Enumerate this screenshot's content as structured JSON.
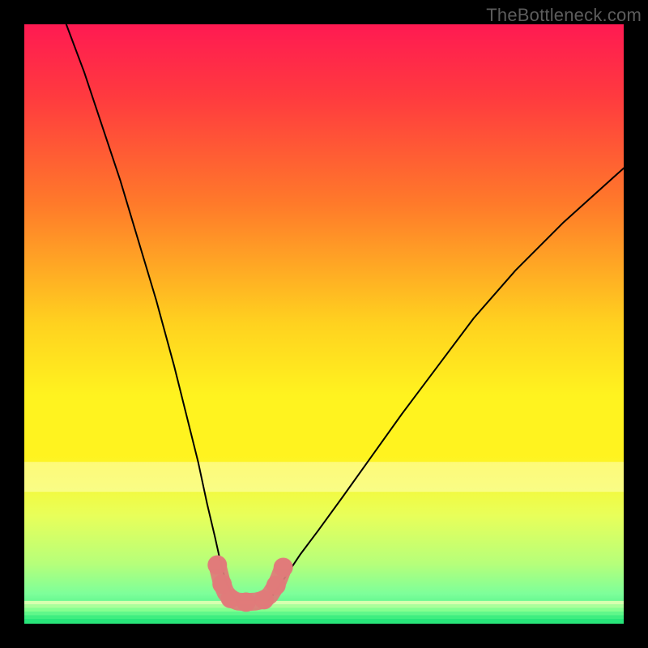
{
  "watermark": "TheBottleneck.com",
  "chart_data": {
    "type": "line",
    "title": "",
    "xlabel": "",
    "ylabel": "",
    "xlim": [
      0,
      100
    ],
    "ylim": [
      0,
      100
    ],
    "grid": false,
    "legend": null,
    "background_gradient": {
      "stops": [
        {
          "pos": 0.0,
          "color": "#ff1a52"
        },
        {
          "pos": 0.12,
          "color": "#ff3a3f"
        },
        {
          "pos": 0.3,
          "color": "#ff7a2a"
        },
        {
          "pos": 0.5,
          "color": "#ffd21f"
        },
        {
          "pos": 0.62,
          "color": "#fff31f"
        },
        {
          "pos": 0.72,
          "color": "#fff31f"
        },
        {
          "pos": 0.82,
          "color": "#e8ff5a"
        },
        {
          "pos": 0.9,
          "color": "#b6ff7a"
        },
        {
          "pos": 0.95,
          "color": "#7dff9a"
        },
        {
          "pos": 1.0,
          "color": "#28e57a"
        }
      ]
    },
    "series": [
      {
        "name": "left-curve",
        "color": "#000000",
        "width": 2,
        "x": [
          7,
          10,
          13,
          16,
          19,
          22,
          25,
          27,
          29,
          30.5,
          31.8,
          32.8,
          33.5,
          34.2,
          34.8,
          35.4
        ],
        "y": [
          100,
          92,
          83,
          74,
          64,
          54,
          43,
          35,
          27,
          20,
          14.5,
          10,
          7.5,
          5.8,
          4.6,
          4.0
        ]
      },
      {
        "name": "right-curve",
        "color": "#000000",
        "width": 2,
        "x": [
          40.8,
          41.5,
          42.5,
          44,
          46,
          49,
          53,
          58,
          63,
          69,
          75,
          82,
          90,
          100
        ],
        "y": [
          4.0,
          4.8,
          6.2,
          8.5,
          11.5,
          15.5,
          21,
          28,
          35,
          43,
          51,
          59,
          67,
          76
        ]
      },
      {
        "name": "floor-band",
        "type": "scatter-band",
        "color": "#e07a7a",
        "points": [
          {
            "x": 32.2,
            "y": 9.8
          },
          {
            "x": 32.6,
            "y": 8.2
          },
          {
            "x": 33.0,
            "y": 6.6
          },
          {
            "x": 33.6,
            "y": 5.2
          },
          {
            "x": 34.4,
            "y": 4.2
          },
          {
            "x": 35.6,
            "y": 3.7
          },
          {
            "x": 37.0,
            "y": 3.6
          },
          {
            "x": 38.6,
            "y": 3.7
          },
          {
            "x": 40.0,
            "y": 4.0
          },
          {
            "x": 41.0,
            "y": 4.8
          },
          {
            "x": 42.0,
            "y": 6.4
          },
          {
            "x": 42.6,
            "y": 7.8
          },
          {
            "x": 43.2,
            "y": 9.4
          }
        ]
      }
    ]
  }
}
